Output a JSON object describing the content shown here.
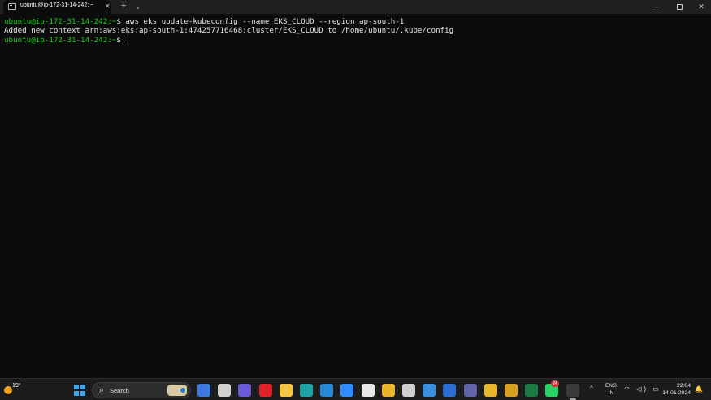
{
  "window": {
    "tab_title": "ubuntu@ip-172-31-14-242: ~",
    "tab_close": "✕",
    "new_tab": "+",
    "tab_menu": "⌄",
    "close_glyph": "✕"
  },
  "terminal": {
    "lines": [
      {
        "prompt": "ubuntu@ip-172-31-14-242:~",
        "symbol": "$",
        "command": " aws eks update-kubeconfig --name EKS_CLOUD --region ap-south-1"
      },
      {
        "output": "Added new context arn:aws:eks:ap-south-1:474257716468:cluster/EKS_CLOUD to /home/ubuntu/.kube/config"
      },
      {
        "prompt": "ubuntu@ip-172-31-14-242:~",
        "symbol": "$",
        "command": " "
      }
    ]
  },
  "taskbar": {
    "weather_temp": "19°",
    "search_label": "Search",
    "search_glyph": "⌕",
    "notification_count": "24",
    "tray_chevron": "^",
    "language": "ENG",
    "region": "IN",
    "tray_glyphs": "◠ ◁) ▭",
    "time": "22:04",
    "date": "14-01-2024",
    "bell_glyph": "🔔",
    "apps": [
      {
        "name": "widgets-app-icon",
        "color": "#3b7be0"
      },
      {
        "name": "task-view-icon",
        "color": "#d0d0d0"
      },
      {
        "name": "video-call-icon",
        "color": "#6b5bd6"
      },
      {
        "name": "opera-icon",
        "color": "#e0232b"
      },
      {
        "name": "file-explorer-icon",
        "color": "#f5c542"
      },
      {
        "name": "edge-icon",
        "color": "#1fa3a3"
      },
      {
        "name": "blue-app-icon",
        "color": "#2a88d8"
      },
      {
        "name": "zoom-icon",
        "color": "#2d8cff"
      },
      {
        "name": "store-icon",
        "color": "#e8e8e8"
      },
      {
        "name": "chrome-icon",
        "color": "#e9b52d"
      },
      {
        "name": "settings-icon",
        "color": "#cfcfcf"
      },
      {
        "name": "mail-icon",
        "color": "#3a8fe0"
      },
      {
        "name": "word-app-icon",
        "color": "#2b6fd6"
      },
      {
        "name": "teams-icon",
        "color": "#6264a7"
      },
      {
        "name": "chrome-profile-icon",
        "color": "#e9b52d"
      },
      {
        "name": "chrome-dev-icon",
        "color": "#d8a020"
      },
      {
        "name": "excel-icon",
        "color": "#1d7a45"
      },
      {
        "name": "whatsapp-icon",
        "color": "#25d366"
      },
      {
        "name": "terminal-app-icon",
        "color": "#3a3a3a"
      }
    ]
  }
}
